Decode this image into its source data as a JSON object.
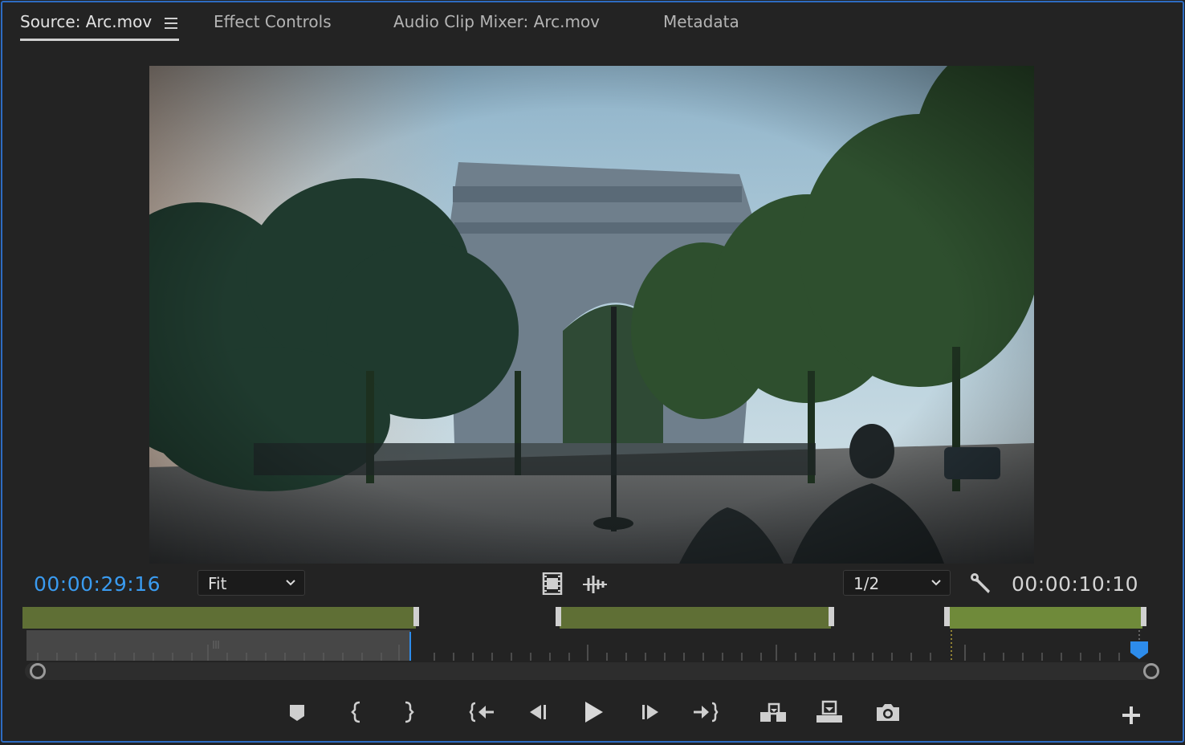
{
  "tabs": [
    {
      "label": "Source: Arc.mov",
      "active": true
    },
    {
      "label": "Effect Controls",
      "active": false
    },
    {
      "label": "Audio Clip Mixer: Arc.mov",
      "active": false
    },
    {
      "label": "Metadata",
      "active": false
    }
  ],
  "playhead_timecode": "00:00:29:16",
  "duration_timecode": "00:00:10:10",
  "zoom_select": {
    "value": "Fit"
  },
  "resolution_select": {
    "value": "1/2"
  },
  "colors": {
    "accent": "#2d8ceb",
    "timecode_blue": "#3a9bf0",
    "clip_green": "#5f6f35",
    "clip_green_bright": "#6f8a3a",
    "panel_border": "#2d6bc2"
  },
  "icons": {
    "tab_menu": "hamburger-icon",
    "video_only": "film-strip-icon",
    "audio_only": "waveform-icon",
    "settings": "wrench-icon",
    "add": "plus-icon"
  },
  "transport": [
    "add-marker-icon",
    "mark-in-icon",
    "mark-out-icon",
    "go-to-in-icon",
    "step-back-icon",
    "play-icon",
    "step-forward-icon",
    "go-to-out-icon",
    "insert-icon",
    "overwrite-icon",
    "export-frame-icon"
  ]
}
